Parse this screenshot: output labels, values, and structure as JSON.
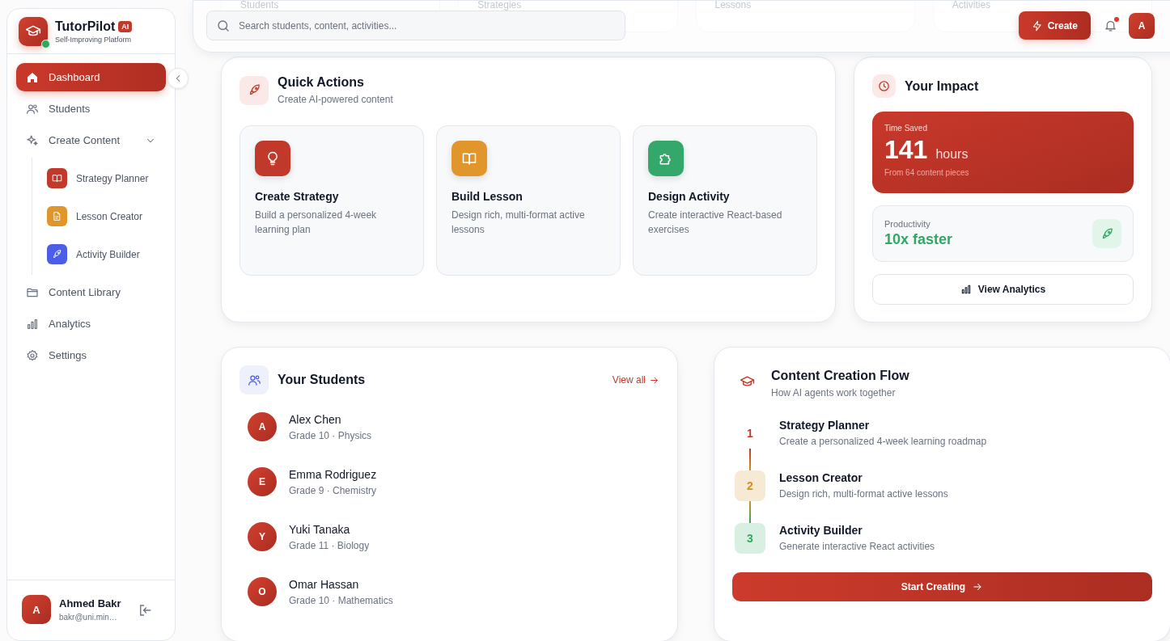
{
  "sidebar": {
    "brand": {
      "name": "TutorPilot",
      "badge": "AI",
      "tagline": "Self-Improving Platform",
      "online": true
    },
    "nav": [
      {
        "kind": "item",
        "label": "Dashboard",
        "selected": true
      },
      {
        "kind": "item",
        "label": "Students",
        "selected": false
      },
      {
        "kind": "group",
        "label": "Create Content",
        "selected": false,
        "expanded": true,
        "children": [
          {
            "label": "Strategy Planner",
            "color": "#c0392b",
            "selected": false
          },
          {
            "label": "Lesson Creator",
            "color": "#e0962a",
            "selected": false
          },
          {
            "label": "Activity Builder",
            "color": "#4a5ee8",
            "selected": false
          }
        ]
      },
      {
        "kind": "item",
        "label": "Content Library",
        "selected": false
      },
      {
        "kind": "item",
        "label": "Analytics",
        "selected": false
      },
      {
        "kind": "item",
        "label": "Settings",
        "selected": false
      }
    ],
    "user": {
      "initial": "A",
      "name": "Ahmed Bakr",
      "email": "bakr@uni.min…"
    }
  },
  "header": {
    "search_placeholder": "Search students, content, activities...",
    "create_label": "Create",
    "has_notifications": true,
    "avatar_initial": "A"
  },
  "stats": [
    {
      "label": "Students"
    },
    {
      "label": "Strategies"
    },
    {
      "label": "Lessons"
    },
    {
      "label": "Activities"
    }
  ],
  "quick_actions": {
    "title": "Quick Actions",
    "subtitle": "Create AI-powered content",
    "actions": [
      {
        "title": "Create Strategy",
        "description": "Build a personalized 4-week learning plan",
        "color": "#c0392b"
      },
      {
        "title": "Build Lesson",
        "description": "Design rich, multi-format active lessons",
        "color": "#e0962a"
      },
      {
        "title": "Design Activity",
        "description": "Create interactive React-based exercises",
        "color": "#34a86a"
      }
    ]
  },
  "impact": {
    "title": "Your Impact",
    "time_saved": {
      "label": "Time Saved",
      "value": "141",
      "unit": "hours",
      "note": "From 64 content pieces"
    },
    "productivity": {
      "label": "Productivity",
      "value": "10x faster"
    },
    "button": "View Analytics"
  },
  "students": {
    "title": "Your Students",
    "view_all": "View all",
    "list": [
      {
        "initial": "A",
        "name": "Alex Chen",
        "detail": "Grade 10 · Physics"
      },
      {
        "initial": "E",
        "name": "Emma Rodriguez",
        "detail": "Grade 9 · Chemistry"
      },
      {
        "initial": "Y",
        "name": "Yuki Tanaka",
        "detail": "Grade 11 · Biology"
      },
      {
        "initial": "O",
        "name": "Omar Hassan",
        "detail": "Grade 10 · Mathematics"
      }
    ]
  },
  "flow": {
    "title": "Content Creation Flow",
    "subtitle": "How AI agents work together",
    "steps": [
      {
        "kind": "plain",
        "number": "1",
        "title": "Strategy Planner",
        "description": "Create a personalized 4-week learning roadmap",
        "color": "#c0392b"
      },
      {
        "kind": "box",
        "number": "2",
        "title": "Lesson Creator",
        "description": "Design rich, multi-format active lessons",
        "color": "#d4901e"
      },
      {
        "kind": "box",
        "number": "3",
        "title": "Activity Builder",
        "description": "Generate interactive React activities",
        "color": "#2fa862"
      }
    ],
    "button": "Start Creating"
  }
}
